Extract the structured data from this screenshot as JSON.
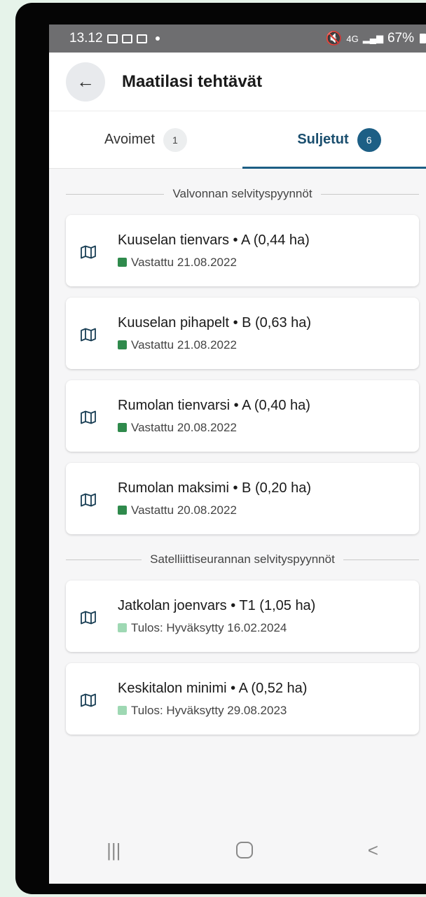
{
  "status_bar": {
    "time": "13.12",
    "network": "4G",
    "battery": "67%"
  },
  "header": {
    "title": "Maatilasi tehtävät",
    "back_icon": "arrow-back-icon"
  },
  "tabs": [
    {
      "label": "Avoimet",
      "count": "1",
      "active": false
    },
    {
      "label": "Suljetut",
      "count": "6",
      "active": true
    }
  ],
  "sections": [
    {
      "title": "Valvonnan selvityspyynnöt",
      "items": [
        {
          "title": "Kuuselan tienvars • A (0,44 ha)",
          "status": "Vastattu 21.08.2022",
          "status_color": "#2f8a4c"
        },
        {
          "title": "Kuuselan pihapelt • B (0,63 ha)",
          "status": "Vastattu 21.08.2022",
          "status_color": "#2f8a4c"
        },
        {
          "title": "Rumolan tienvarsi • A (0,40 ha)",
          "status": "Vastattu 20.08.2022",
          "status_color": "#2f8a4c"
        },
        {
          "title": "Rumolan maksimi • B (0,20 ha)",
          "status": "Vastattu 20.08.2022",
          "status_color": "#2f8a4c"
        }
      ]
    },
    {
      "title": "Satelliittiseurannan selvityspyynnöt",
      "items": [
        {
          "title": "Jatkolan joenvars • T1 (1,05 ha)",
          "status": "Tulos: Hyväksytty 16.02.2024",
          "status_color": "#9ed8b3"
        },
        {
          "title": "Keskitalon minimi • A (0,52 ha)",
          "status": "Tulos: Hyväksytty 29.08.2023",
          "status_color": "#9ed8b3"
        }
      ]
    }
  ],
  "colors": {
    "accent": "#1d5f85",
    "answered": "#2f8a4c",
    "approved": "#9ed8b3"
  },
  "nav": {
    "recents_icon": "recents-icon",
    "home_icon": "home-icon",
    "back_icon": "nav-back-icon"
  }
}
